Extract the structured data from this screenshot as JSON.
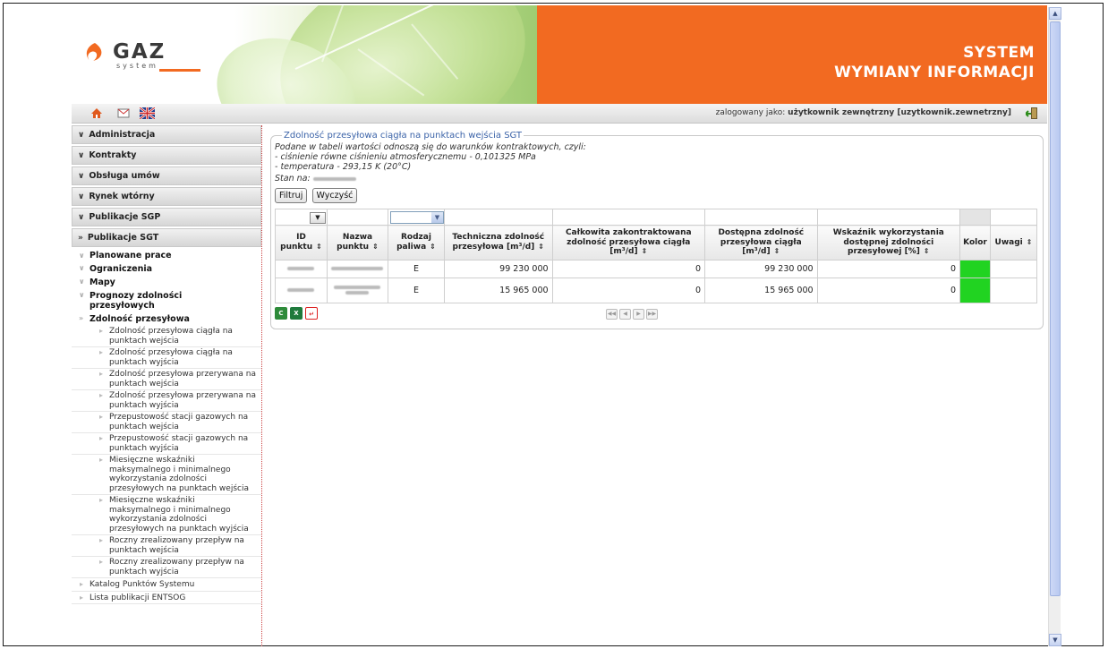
{
  "header": {
    "logo_word": "GAZ",
    "logo_sub": "system",
    "title_line1": "SYSTEM",
    "title_line2": "WYMIANY INFORMACJI"
  },
  "toolbar": {
    "icons": [
      "home-icon",
      "mail-icon",
      "uk-flag-icon"
    ],
    "login_prefix": "zalogowany jako:",
    "login_user": "użytkownik zewnętrzny [uzytkownik.zewnetrzny]"
  },
  "sidebar": {
    "sections": [
      "Administracja",
      "Kontrakty",
      "Obsługa umów",
      "Rynek wtórny",
      "Publikacje SGP"
    ],
    "open_section": "Publikacje SGT",
    "sub_items": [
      "Planowane prace",
      "Ograniczenia",
      "Mapy",
      "Prognozy zdolności przesyłowych",
      "Zdolność przesyłowa"
    ],
    "leaf_items": [
      "Zdolność przesyłowa ciągła na punktach wejścia",
      "Zdolność przesyłowa ciągła na punktach wyjścia",
      "Zdolność przesyłowa przerywana na punktach wejścia",
      "Zdolność przesyłowa przerywana na punktach wyjścia",
      "Przepustowość stacji gazowych na punktach wejścia",
      "Przepustowość stacji gazowych na punktach wyjścia",
      "Miesięczne wskaźniki maksymalnego i minimalnego wykorzystania zdolności przesyłowych na punktach wejścia",
      "Miesięczne wskaźniki maksymalnego i minimalnego wykorzystania zdolności przesyłowych na punktach wyjścia",
      "Roczny zrealizowany przepływ na punktach wejścia",
      "Roczny zrealizowany przepływ na punktach wyjścia"
    ],
    "bottom_items": [
      "Katalog Punktów Systemu",
      "Lista publikacji ENTSOG"
    ]
  },
  "content": {
    "legend": "Zdolność przesyłowa ciągła na punktach wejścia SGT",
    "note_line1": "Podane w tabeli wartości odnoszą się do warunków kontraktowych, czyli:",
    "note_line2": "- ciśnienie równe ciśnieniu atmosferycznemu - 0,101325 MPa",
    "note_line3": "- temperatura - 293,15 K (20°C)",
    "stan_label": "Stan na:",
    "filter_button": "Filtruj",
    "clear_button": "Wyczyść",
    "columns": [
      "ID punktu",
      "Nazwa punktu",
      "Rodzaj paliwa",
      "Techniczna zdolność przesyłowa [m³/d]",
      "Całkowita zakontraktowana zdolność przesyłowa ciągła [m³/d]",
      "Dostępna zdolność przesyłowa ciągła [m³/d]",
      "Wskaźnik wykorzystania dostępnej zdolności przesyłowej [%]",
      "Kolor",
      "Uwagi"
    ],
    "rows": [
      {
        "fuel": "E",
        "technical": "99 230 000",
        "contracted": "0",
        "available": "99 230 000",
        "ratio": "0",
        "color": "#21d321"
      },
      {
        "fuel": "E",
        "technical": "15 965 000",
        "contracted": "0",
        "available": "15 965 000",
        "ratio": "0",
        "color": "#21d321"
      }
    ],
    "export_icons": [
      "csv-export-icon",
      "excel-export-icon",
      "pdf-export-icon"
    ],
    "pager_icons": [
      "first-page-icon",
      "prev-page-icon",
      "next-page-icon",
      "last-page-icon"
    ]
  }
}
